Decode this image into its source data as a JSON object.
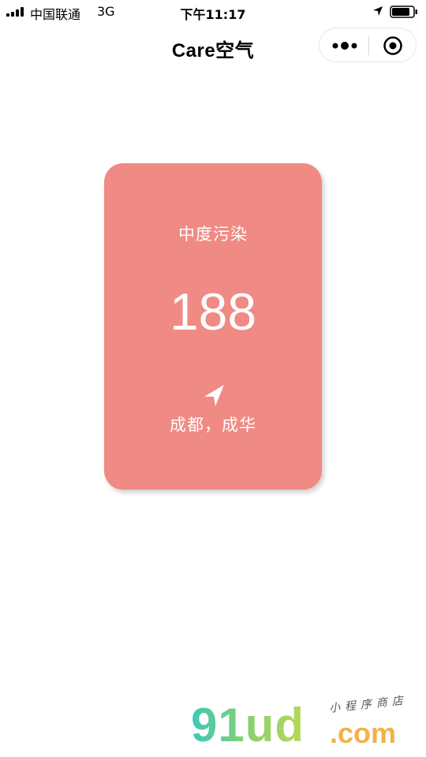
{
  "status_bar": {
    "carrier": "中国联通",
    "network": "3G",
    "time": "下午11:17",
    "icons": [
      "signal-icon",
      "location-arrow-icon",
      "battery-icon"
    ]
  },
  "nav": {
    "title": "Care空气",
    "capsule_icons": [
      "more-icon",
      "close-target-icon"
    ]
  },
  "aqi": {
    "level": "中度污染",
    "value": "188",
    "location": "成都，成华",
    "card_color": "#f08a84",
    "icon": "navigation-arrow-icon"
  },
  "watermark": {
    "main": "91ud",
    "domain": ".com",
    "subtitle": "小程序商店"
  }
}
